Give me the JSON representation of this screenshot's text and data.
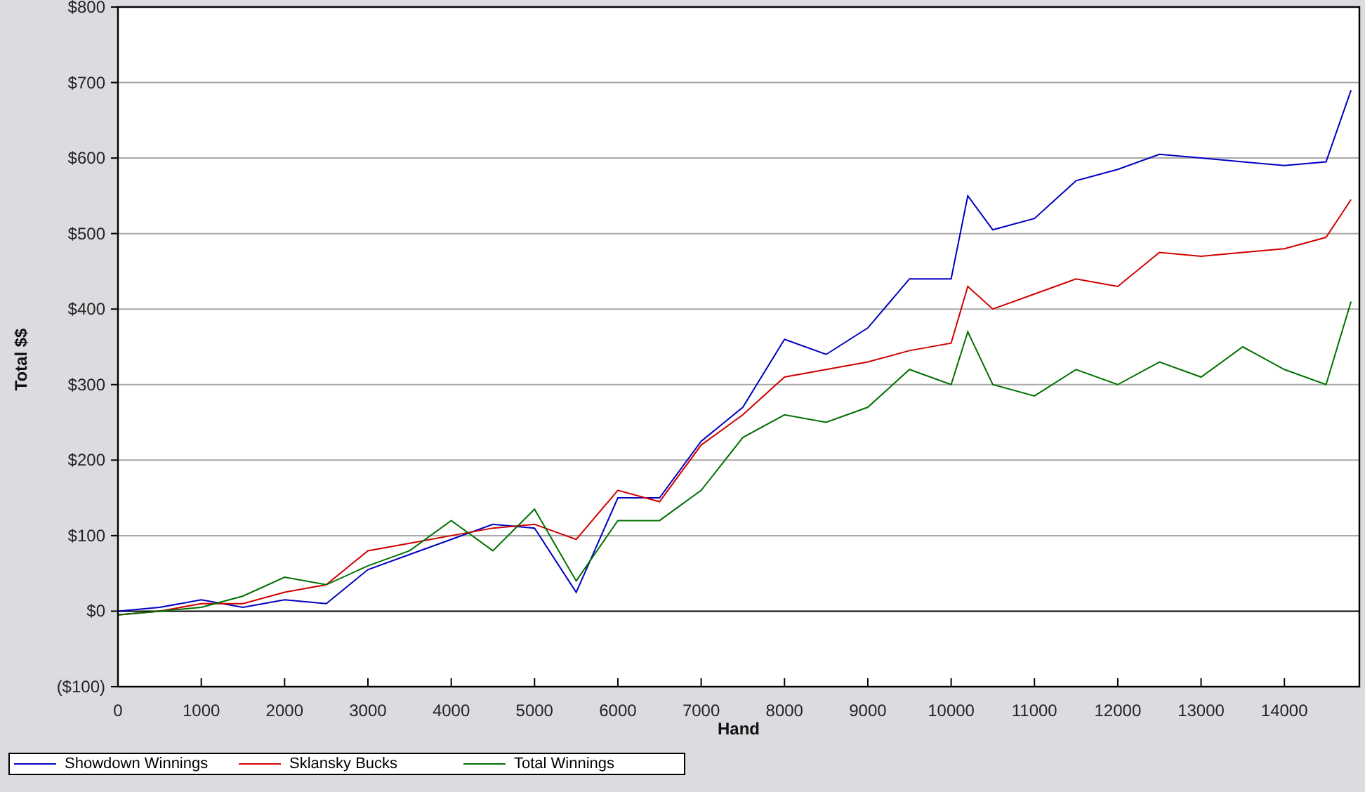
{
  "chart_data": {
    "type": "line",
    "xlabel": "Hand",
    "ylabel": "Total $$",
    "x": [
      0,
      500,
      1000,
      1500,
      2000,
      2500,
      3000,
      3500,
      4000,
      4500,
      5000,
      5500,
      6000,
      6500,
      7000,
      7500,
      8000,
      8500,
      9000,
      9500,
      10000,
      10200,
      10500,
      11000,
      11500,
      12000,
      12500,
      13000,
      13500,
      14000,
      14500,
      14800
    ],
    "series": [
      {
        "name": "Showdown Winnings",
        "color": "#0000c0",
        "values": [
          0,
          5,
          15,
          5,
          15,
          10,
          55,
          75,
          95,
          115,
          110,
          25,
          150,
          150,
          225,
          270,
          360,
          340,
          375,
          440,
          440,
          550,
          505,
          520,
          570,
          585,
          605,
          600,
          595,
          590,
          595,
          690
        ]
      },
      {
        "name": "Sklansky Bucks",
        "color": "#d00000",
        "values": [
          -5,
          0,
          10,
          10,
          25,
          35,
          80,
          90,
          100,
          110,
          115,
          95,
          160,
          145,
          220,
          260,
          310,
          320,
          330,
          345,
          355,
          430,
          400,
          420,
          440,
          430,
          475,
          470,
          475,
          480,
          495,
          545
        ]
      },
      {
        "name": "Total Winnings",
        "color": "#007000",
        "values": [
          -5,
          0,
          5,
          20,
          45,
          35,
          60,
          80,
          120,
          80,
          135,
          40,
          120,
          120,
          160,
          230,
          260,
          250,
          270,
          320,
          300,
          370,
          300,
          285,
          320,
          300,
          330,
          310,
          350,
          320,
          300,
          410
        ]
      }
    ],
    "grid": true,
    "xlim": [
      0,
      14900
    ],
    "ylim": [
      -100,
      800
    ],
    "xticks": [
      0,
      1000,
      2000,
      3000,
      4000,
      5000,
      6000,
      7000,
      8000,
      9000,
      10000,
      11000,
      12000,
      13000,
      14000
    ],
    "yticks": [
      {
        "value": -100,
        "label": "($100)"
      },
      {
        "value": 0,
        "label": "$0"
      },
      {
        "value": 100,
        "label": "$100"
      },
      {
        "value": 200,
        "label": "$200"
      },
      {
        "value": 300,
        "label": "$300"
      },
      {
        "value": 400,
        "label": "$400"
      },
      {
        "value": 500,
        "label": "$500"
      },
      {
        "value": 600,
        "label": "$600"
      },
      {
        "value": 700,
        "label": "$700"
      },
      {
        "value": 800,
        "label": "$800"
      }
    ]
  }
}
